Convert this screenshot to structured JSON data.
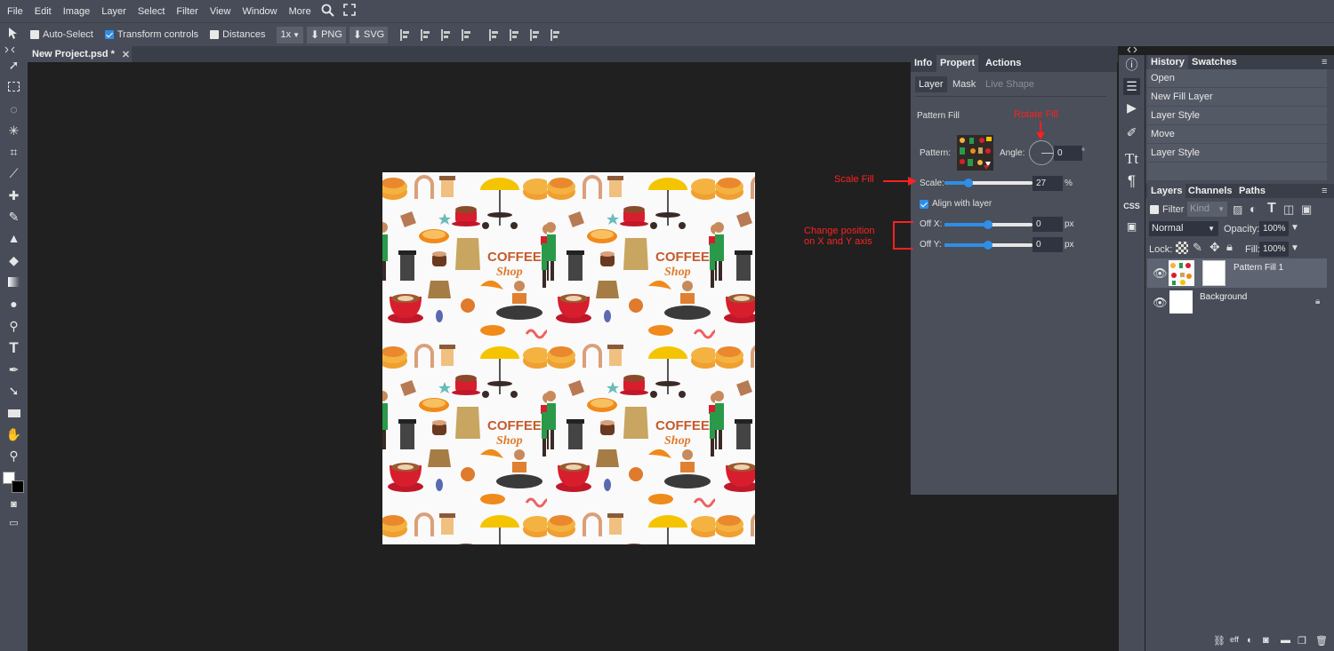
{
  "menu": [
    "File",
    "Edit",
    "Image",
    "Layer",
    "Select",
    "Filter",
    "View",
    "Window",
    "More"
  ],
  "options": {
    "auto_select": "Auto-Select",
    "transform_controls": "Transform controls",
    "distances": "Distances",
    "zoom": "1x",
    "png": "PNG",
    "svg": "SVG"
  },
  "document": {
    "tab_title": "New Project.psd *",
    "close": "✕"
  },
  "properties": {
    "tabs": [
      "Info",
      "Propert",
      "Actions"
    ],
    "subtabs": [
      "Layer",
      "Mask",
      "Live Shape"
    ],
    "section": "Pattern Fill",
    "pattern_label": "Pattern:",
    "angle_label": "Angle:",
    "angle_value": "0",
    "degree": "°",
    "scale_label": "Scale:",
    "scale_value": "27",
    "scale_percent": 27,
    "scale_unit": "%",
    "align_label": "Align with layer",
    "offx_label": "Off X:",
    "offx_value": "0",
    "offy_label": "Off Y:",
    "offy_value": "0",
    "px": "px"
  },
  "annotations": {
    "rotate": "Rotate Fill",
    "scale": "Scale Fill",
    "position_line1": "Change position",
    "position_line2": "on X and Y axis"
  },
  "history": {
    "tabs": [
      "History",
      "Swatches"
    ],
    "items": [
      "Open",
      "New Fill Layer",
      "Layer Style",
      "Move",
      "Layer Style"
    ]
  },
  "layers": {
    "tabs": [
      "Layers",
      "Channels",
      "Paths"
    ],
    "filter_label": "Filter",
    "kind": "Kind",
    "blend_mode": "Normal",
    "opacity_label": "Opacity:",
    "opacity_value": "100%",
    "lock_label": "Lock:",
    "fill_label": "Fill:",
    "fill_value": "100%",
    "items": [
      "Pattern Fill 1",
      "Background"
    ]
  },
  "colors": {
    "accent": "#2f8ee6",
    "annotation": "#ff2020",
    "panel": "#474c58",
    "canvas_bg": "#202020"
  }
}
